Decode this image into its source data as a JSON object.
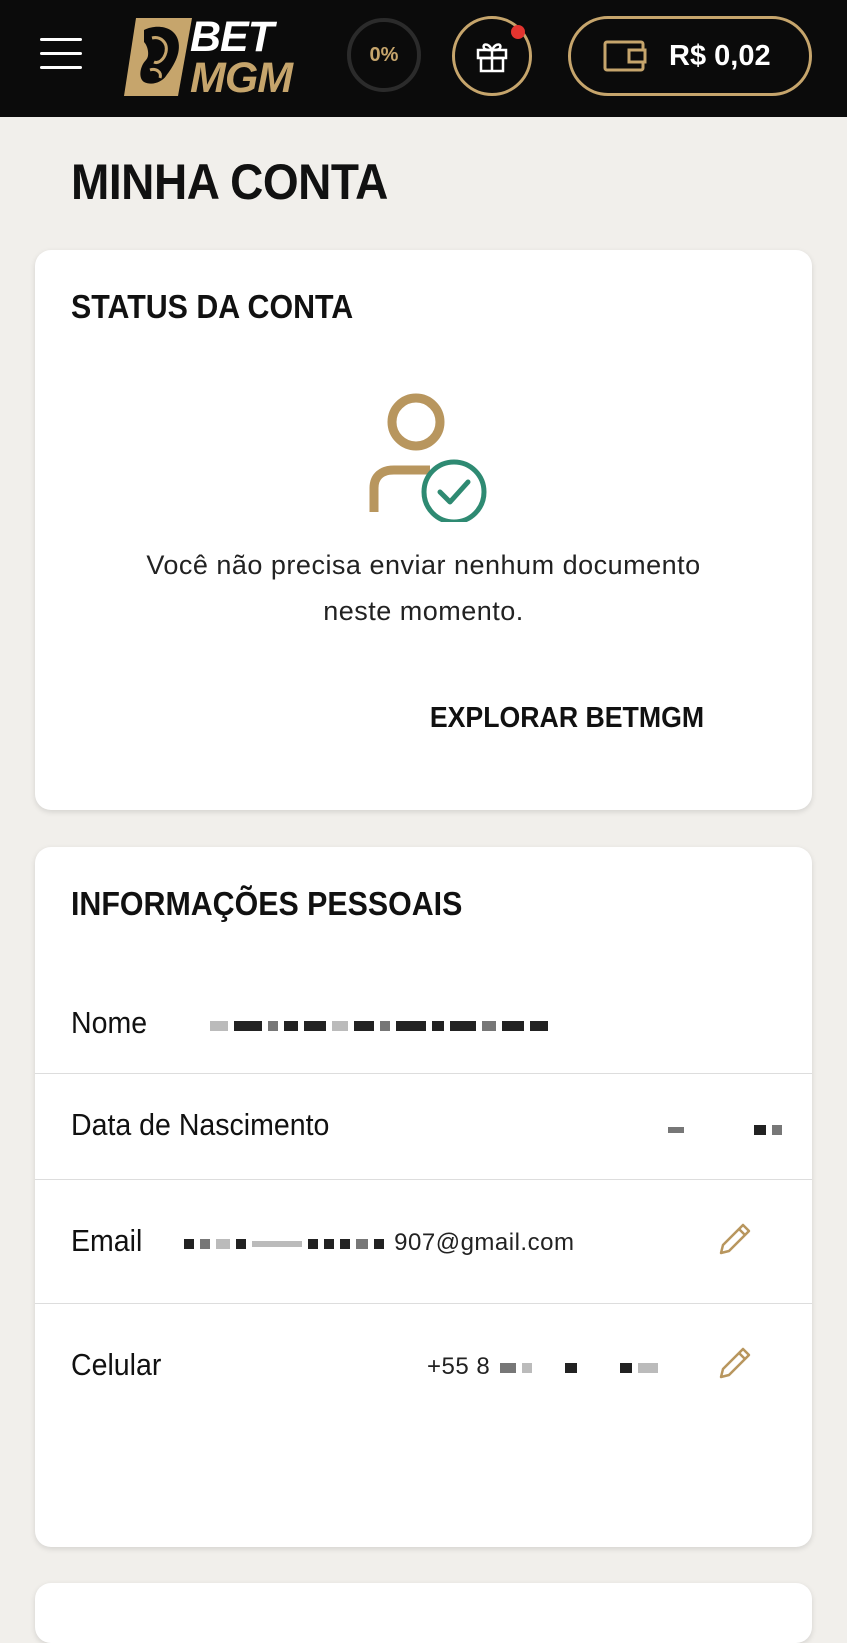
{
  "header": {
    "logo_bet": "BET",
    "logo_mgm": "MGM",
    "progress": "0%",
    "balance": "R$ 0,02"
  },
  "page": {
    "title": "MINHA CONTA"
  },
  "status_card": {
    "title": "STATUS DA CONTA",
    "message_line1": "Você não precisa enviar nenhum documento",
    "message_line2": "neste momento.",
    "explore_label": "EXPLORAR BETMGM"
  },
  "personal_info": {
    "title": "INFORMAÇÕES PESSOAIS",
    "rows": [
      {
        "label": "Nome",
        "value": ""
      },
      {
        "label": "Data de Nascimento",
        "value": ""
      },
      {
        "label": "Email",
        "value": "907@gmail.com"
      },
      {
        "label": "Celular",
        "value": "+55 8"
      }
    ]
  },
  "colors": {
    "gold": "#c6a56c",
    "check_green": "#2e8a72",
    "notification_red": "#e3342f",
    "header_bg": "#0b0b0b"
  },
  "icons": {
    "menu": "hamburger-icon",
    "gift": "gift-icon",
    "wallet": "wallet-icon",
    "user_verified": "user-check-icon",
    "edit": "pencil-icon"
  }
}
